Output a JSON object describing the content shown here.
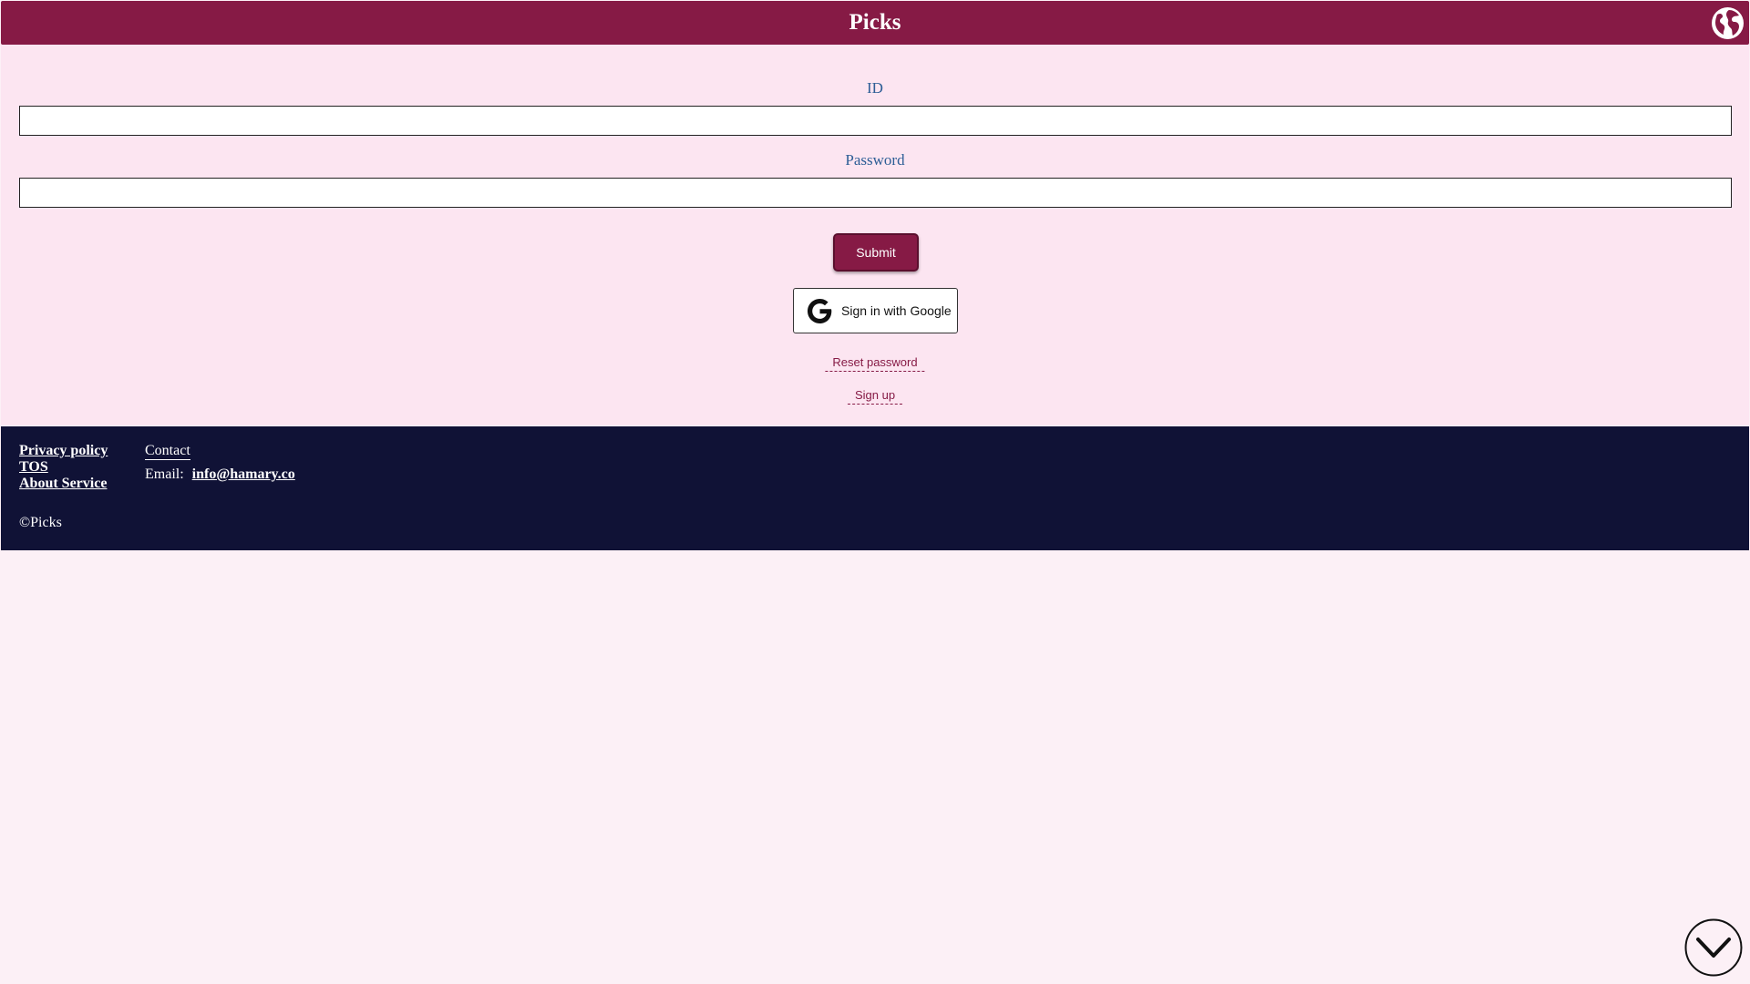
{
  "header": {
    "title": "Picks",
    "language_icon": "globe-icon"
  },
  "login_form": {
    "id_label": "ID",
    "id_value": "",
    "password_label": "Password",
    "password_value": "",
    "submit_label": "Submit",
    "google_label": "Sign in with Google",
    "google_icon": "google-g-icon",
    "reset_password_label": "Reset password",
    "sign_up_label": "Sign up"
  },
  "footer": {
    "privacy_policy": "Privacy policy",
    "tos": "TOS",
    "about_service": "About Service",
    "contact_title": "Contact",
    "email_label": "Email:",
    "email_value": "info@hamary.co",
    "copyright": "©Picks"
  },
  "scroll_button": {
    "icon": "chevron-down-icon"
  },
  "colors": {
    "brand": "#861a45",
    "page_bg": "#fcf0f6",
    "main_bg": "#fce5f1",
    "footer_bg": "#101236",
    "label_color": "#2d5e96"
  }
}
